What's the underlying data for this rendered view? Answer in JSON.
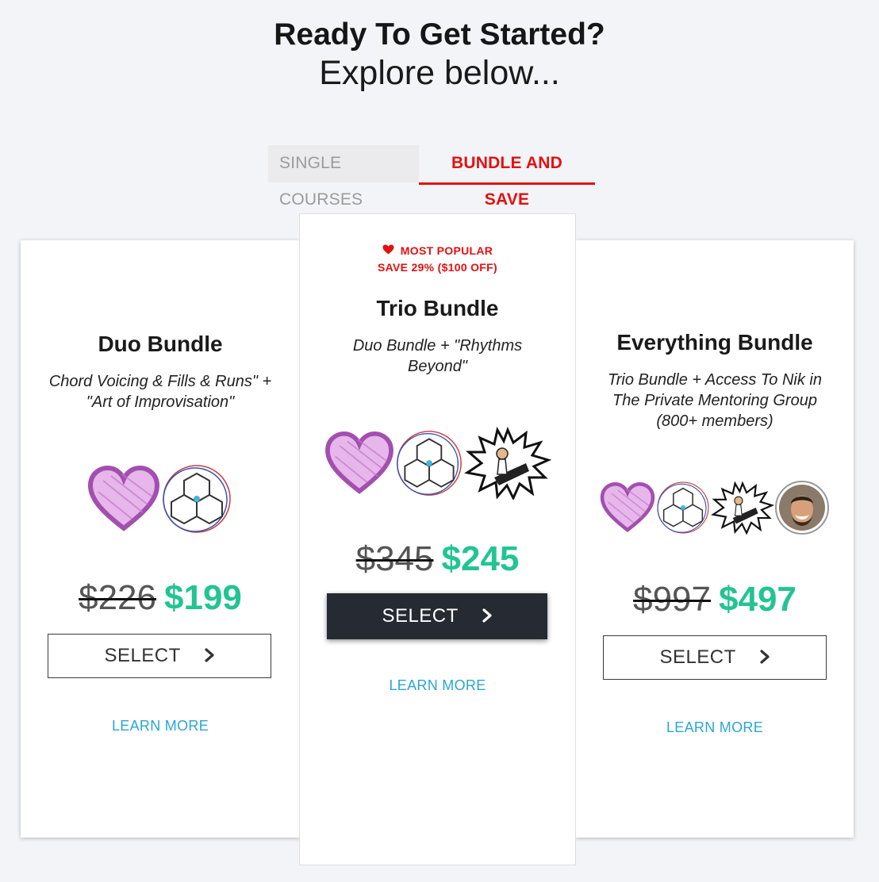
{
  "header": {
    "title": "Ready To Get Started?",
    "subtitle": "Explore below..."
  },
  "tabs": [
    {
      "label": "SINGLE COURSES",
      "active": false
    },
    {
      "label": "BUNDLE AND SAVE",
      "active": true
    }
  ],
  "colors": {
    "accent_red": "#e41010",
    "price_green": "#22c493",
    "link_blue": "#2ba6d4",
    "dark_button": "#262a33"
  },
  "cards": [
    {
      "title": "Duo Bundle",
      "description": "Chord Voicing & Fills & Runs\" + \"Art of Improvisation\"",
      "icons": [
        "heart-sketch-icon",
        "cubes-circle-icon"
      ],
      "old_price": "$226",
      "new_price": "$199",
      "select_label": "SELECT",
      "learn_more": "LEARN MORE"
    },
    {
      "badge": "MOST POPULAR",
      "badge_icon": "heart-icon",
      "savings": "SAVE 29% ($100 OFF)",
      "title": "Trio Bundle",
      "description": "Duo Bundle + \"Rhythms Beyond\"",
      "icons": [
        "heart-sketch-icon",
        "cubes-circle-icon",
        "pianist-burst-icon"
      ],
      "old_price": "$345",
      "new_price": "$245",
      "select_label": "SELECT",
      "learn_more": "LEARN MORE"
    },
    {
      "title": "Everything Bundle",
      "description": "Trio Bundle + Access To Nik in The Private Mentoring Group (800+ members)",
      "icons": [
        "heart-sketch-icon",
        "cubes-circle-icon",
        "pianist-burst-icon",
        "mentor-avatar"
      ],
      "old_price": "$997",
      "new_price": "$497",
      "select_label": "SELECT",
      "learn_more": "LEARN MORE"
    }
  ]
}
